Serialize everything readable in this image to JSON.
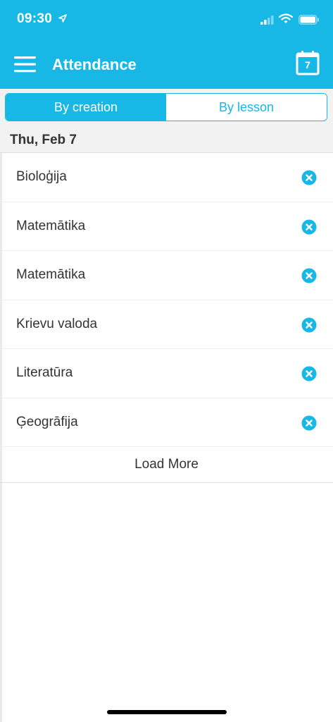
{
  "status_bar": {
    "time": "09:30",
    "icons": [
      "location-arrow-icon",
      "signal-icon",
      "wifi-icon",
      "battery-icon"
    ]
  },
  "app_bar": {
    "title": "Attendance",
    "calendar_day": "7",
    "menu_icon": "hamburger-menu-icon",
    "calendar_icon": "calendar-icon",
    "accent_color": "#17b7e6"
  },
  "segmented_control": {
    "options": [
      {
        "label": "By creation",
        "selected": true
      },
      {
        "label": "By lesson",
        "selected": false
      }
    ]
  },
  "date_header": "Thu, Feb 7",
  "lessons": [
    {
      "name": "Bioloģija"
    },
    {
      "name": "Matemātika"
    },
    {
      "name": "Matemātika"
    },
    {
      "name": "Krievu valoda"
    },
    {
      "name": "Literatūra"
    },
    {
      "name": "Ģeogrāfija"
    }
  ],
  "load_more_label": "Load More"
}
